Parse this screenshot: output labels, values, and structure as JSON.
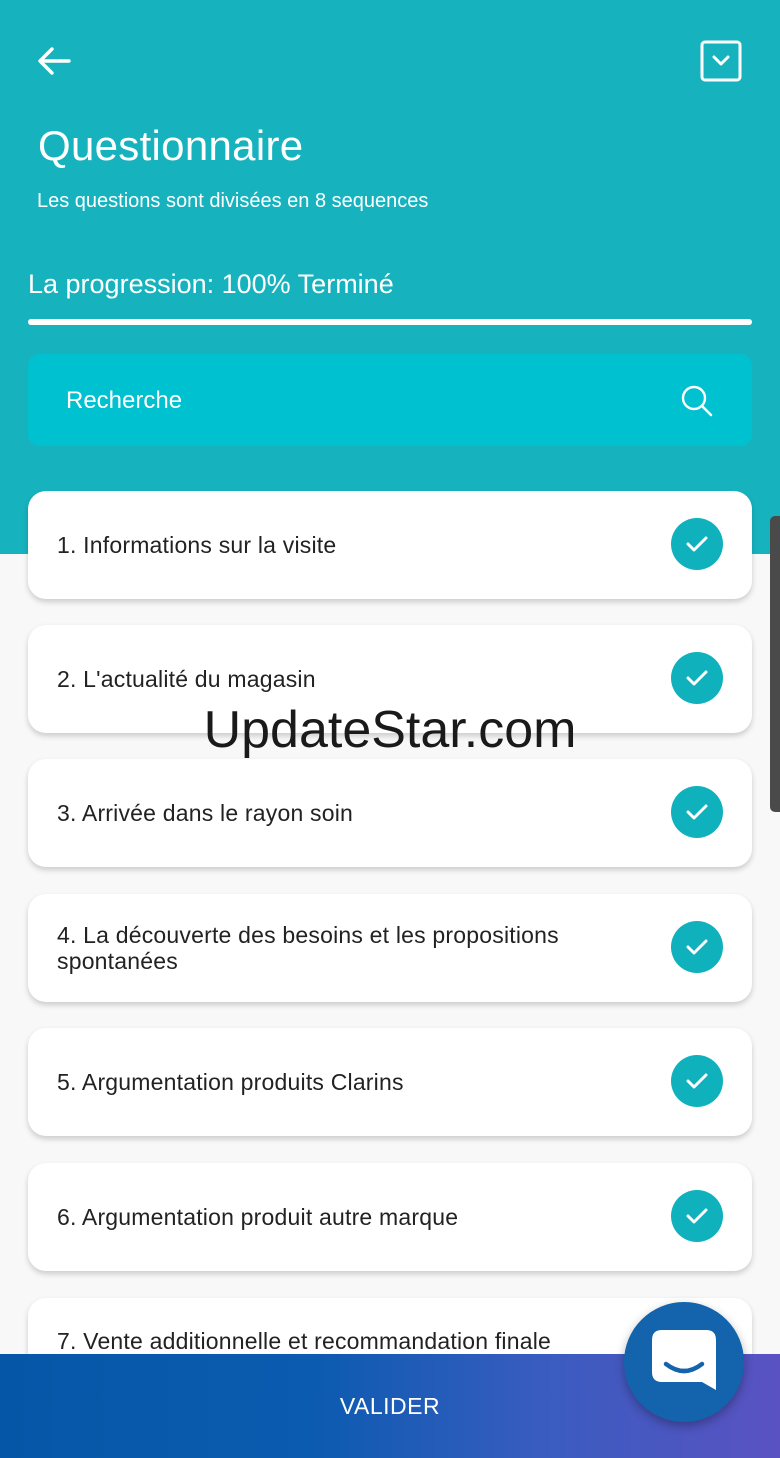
{
  "header": {
    "title": "Questionnaire",
    "subtitle": "Les questions sont divisées en 8 sequences",
    "progress_label": "La progression: 100% Terminé",
    "progress_fraction": 1.0
  },
  "search": {
    "placeholder": "Recherche"
  },
  "sequences": [
    {
      "label": "1. Informations sur la visite",
      "completed": true
    },
    {
      "label": "2. L'actualité du magasin",
      "completed": true
    },
    {
      "label": "3. Arrivée dans le rayon soin",
      "completed": true
    },
    {
      "label": "4. La découverte des besoins et les propositions spontanées",
      "completed": true
    },
    {
      "label": "5. Argumentation produits Clarins",
      "completed": true
    },
    {
      "label": "6. Argumentation produit autre marque",
      "completed": true
    },
    {
      "label": "7. Vente additionnelle et recommandation finale",
      "completed": true
    }
  ],
  "footer": {
    "submit_label": "VALIDER"
  },
  "watermark": "UpdateStar.com",
  "icons": {
    "back": "arrow-left-icon",
    "collapse": "chevron-down-box-icon",
    "search": "search-icon",
    "check": "check-icon",
    "chat": "chat-icon"
  },
  "colors": {
    "header": "#16b3bf",
    "search_bg": "#00c1cf",
    "check": "#0fb1bd",
    "footer_start": "#0656a8",
    "footer_end": "#5a52c2",
    "fab": "#1464ad"
  }
}
